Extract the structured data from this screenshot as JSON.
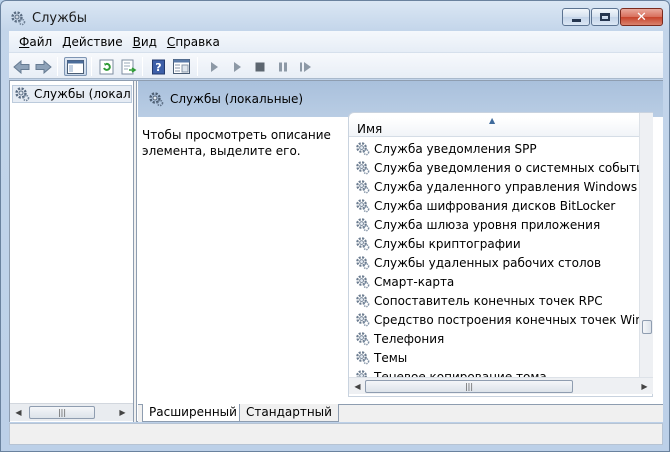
{
  "window": {
    "title": "Службы",
    "icon": "services-gear-icon"
  },
  "menu": [
    {
      "label": "Файл",
      "accel": "Ф",
      "rest": "айл"
    },
    {
      "label": "Действие",
      "accel": "Д",
      "rest": "ействие"
    },
    {
      "label": "Вид",
      "accel": "В",
      "rest": "ид"
    },
    {
      "label": "Справка",
      "accel": "С",
      "rest": "правка"
    }
  ],
  "toolbar": {
    "buttons": [
      "back-arrow-icon",
      "forward-arrow-icon",
      "show-hide-console-tree-icon",
      "refresh-icon",
      "export-list-icon",
      "help-icon",
      "properties-icon",
      "start-service-icon",
      "start-service-alt-icon",
      "stop-service-icon",
      "pause-service-icon",
      "restart-service-icon"
    ]
  },
  "tree": {
    "selected_label": "Службы (локалы"
  },
  "pane": {
    "header_title": "Службы (локальные)",
    "description": "Чтобы просмотреть описание элемента, выделите его.",
    "column_name": "Имя",
    "services": [
      "Служба уведомления SPP",
      "Служба уведомления о системных событиях",
      "Служба удаленного управления Windows (WS...",
      "Служба шифрования дисков BitLocker",
      "Служба шлюза уровня приложения",
      "Службы криптографии",
      "Службы удаленных рабочих столов",
      "Смарт-карта",
      "Сопоставитель конечных точек RPC",
      "Средство построения конечных точек Windo...",
      "Телефония",
      "Темы",
      "Теневое копирование тома"
    ]
  },
  "tabs": {
    "extended": "Расширенный",
    "standard": "Стандартный"
  },
  "colors": {
    "header_blue": "#a9c0dc",
    "frame_blue": "#bcd0e8"
  }
}
